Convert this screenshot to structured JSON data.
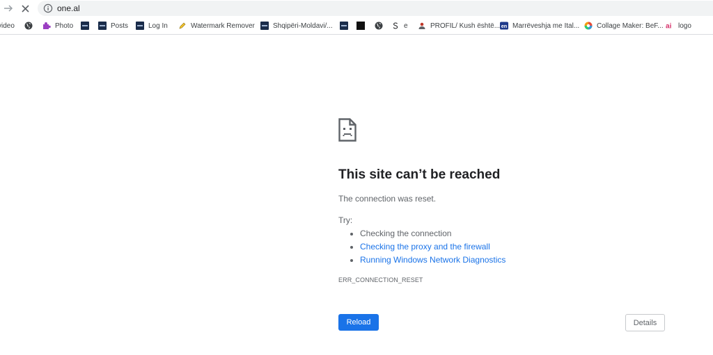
{
  "browser": {
    "url": "one.al",
    "bookmarks": [
      {
        "label": "video",
        "icon": "none"
      },
      {
        "label": "",
        "icon": "globe-icon"
      },
      {
        "label": "Photo",
        "icon": "puzzle-icon"
      },
      {
        "label": "",
        "icon": "news-icon"
      },
      {
        "label": "Posts",
        "icon": "news-icon"
      },
      {
        "label": "Log In",
        "icon": "news-icon"
      },
      {
        "label": "Watermark Remover",
        "icon": "pencil-icon"
      },
      {
        "label": "Shqipëri-Moldavi/...",
        "icon": "news-icon"
      },
      {
        "label": "",
        "icon": "news-icon"
      },
      {
        "label": "",
        "icon": "dark-square-icon"
      },
      {
        "label": "",
        "icon": "globe-icon"
      },
      {
        "label": "e",
        "icon": "serif-s-icon"
      },
      {
        "label": "PROFIL/ Kush është...",
        "icon": "person-icon"
      },
      {
        "label": "Marrëveshja me Ital...",
        "icon": "en-icon"
      },
      {
        "label": "Collage Maker: BeF...",
        "icon": "colorwheel-icon"
      },
      {
        "label": "logo",
        "icon": "ai-icon"
      }
    ]
  },
  "error": {
    "title": "This site can’t be reached",
    "message": "The connection was reset.",
    "try_label": "Try:",
    "suggestions": [
      {
        "text": "Checking the connection",
        "link": false
      },
      {
        "text": "Checking the proxy and the firewall",
        "link": true
      },
      {
        "text": "Running Windows Network Diagnostics",
        "link": true
      }
    ],
    "code": "ERR_CONNECTION_RESET",
    "reload_label": "Reload",
    "details_label": "Details"
  },
  "colors": {
    "primary": "#1a73e8",
    "text": "#202124",
    "secondary_text": "#5f6368",
    "url_bar": "#f1f3f4"
  }
}
